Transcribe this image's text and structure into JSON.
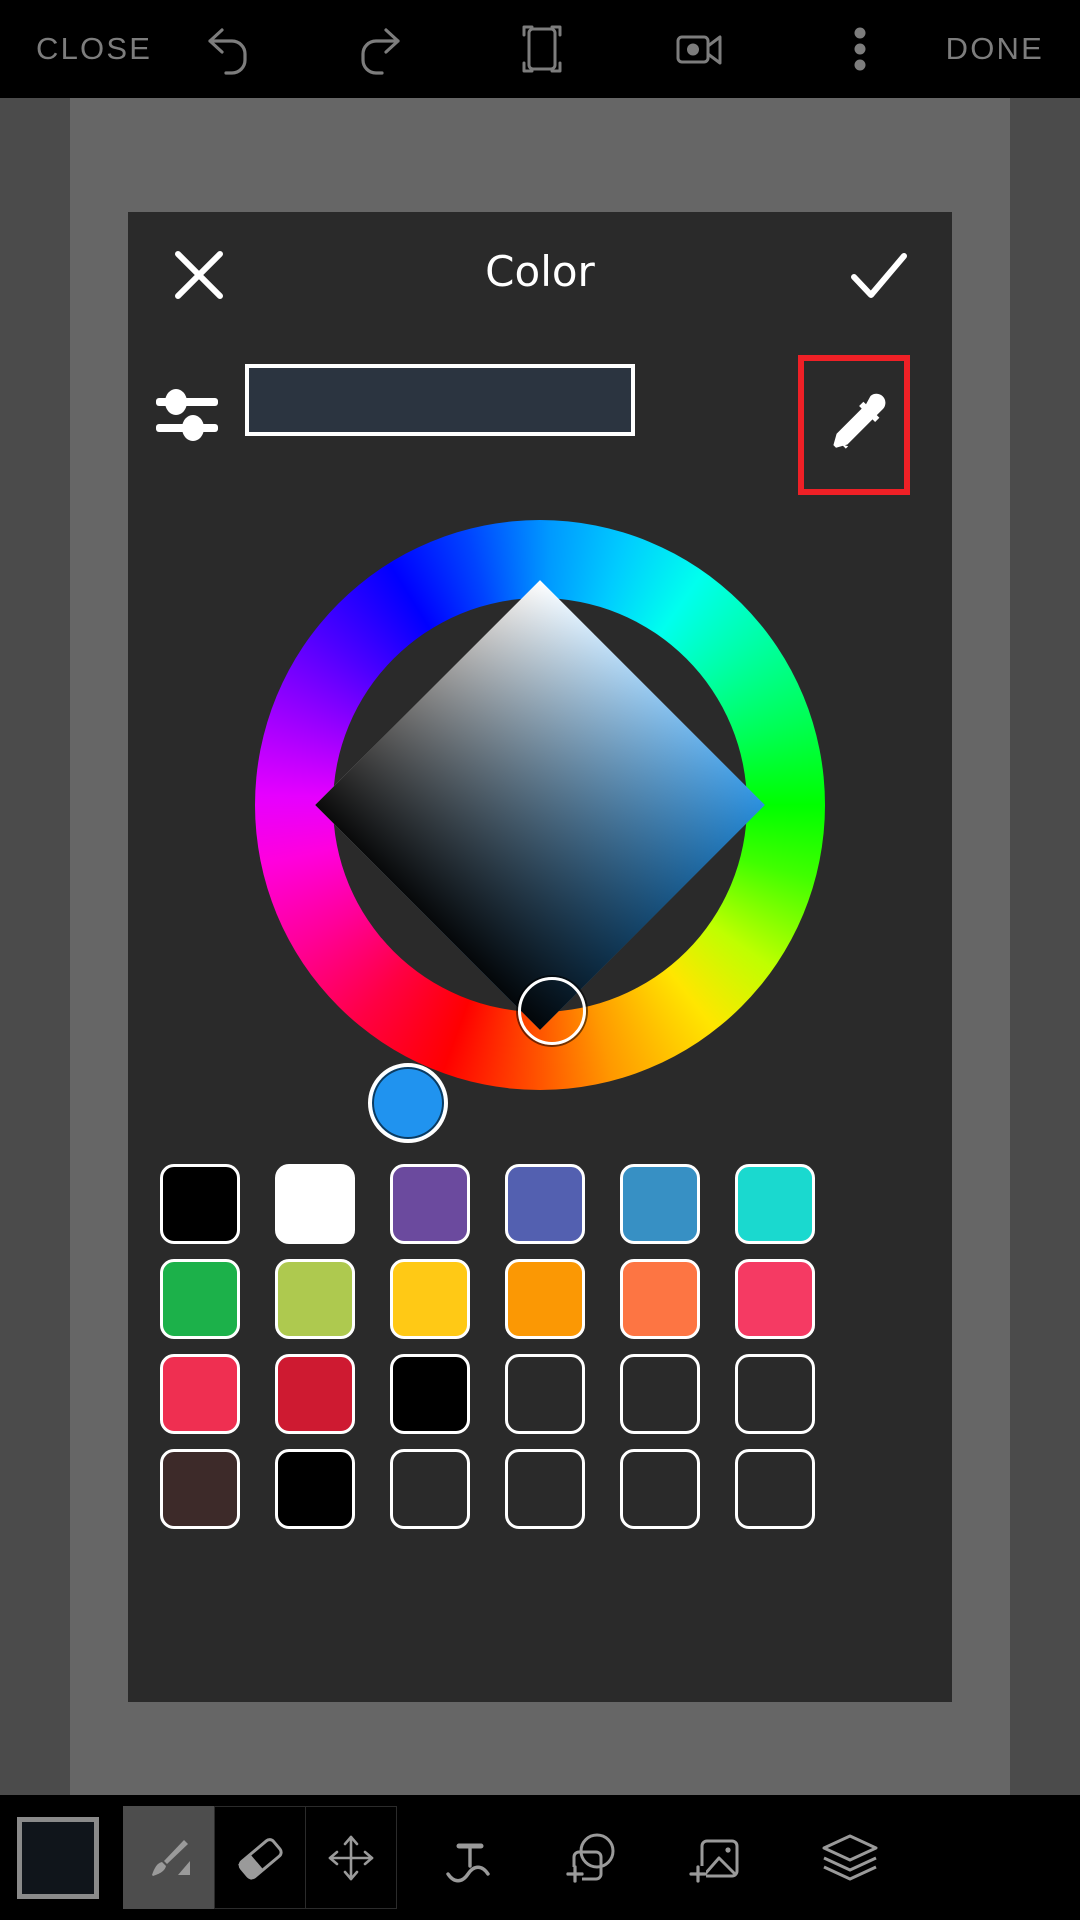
{
  "topbar": {
    "close_label": "CLOSE",
    "done_label": "DONE",
    "icons": [
      "undo-icon",
      "redo-icon",
      "crop-icon",
      "camera-icon",
      "overflow-menu-icon"
    ],
    "text_color": "#7d7d7d",
    "background": "#000000"
  },
  "canvas": {
    "backdrop_color": "#4b4b4b",
    "page_color": "#666666"
  },
  "dialog": {
    "title": "Color",
    "background": "#2a2a2a",
    "close_icon": "close-x-icon",
    "confirm_icon": "check-icon",
    "sliders_icon": "sliders-icon",
    "eyedropper_icon": "eyedropper-icon",
    "preview_color": "#2b3440",
    "highlight_color": "#ef2026",
    "highlight_target": "eyedropper-button"
  },
  "wheel": {
    "type": "hue-ring-with-sv-diamond",
    "selected_hue_color": "#2093ef",
    "sv_handle_color": "#1d232b",
    "diamond_tint": "#2a8fdd"
  },
  "swatches": [
    {
      "name": "black",
      "color": "#000000",
      "empty": false
    },
    {
      "name": "white",
      "color": "#ffffff",
      "empty": false
    },
    {
      "name": "purple",
      "color": "#6b4a9e",
      "empty": false
    },
    {
      "name": "indigo",
      "color": "#5360b0",
      "empty": false
    },
    {
      "name": "steel-blue",
      "color": "#3790c4",
      "empty": false
    },
    {
      "name": "turquoise",
      "color": "#1ad9cf",
      "empty": false
    },
    {
      "name": "green",
      "color": "#1cb14a",
      "empty": false
    },
    {
      "name": "yellow-green",
      "color": "#aec94f",
      "empty": false
    },
    {
      "name": "gold",
      "color": "#ffc915",
      "empty": false
    },
    {
      "name": "orange",
      "color": "#fb9804",
      "empty": false
    },
    {
      "name": "coral",
      "color": "#fd7543",
      "empty": false
    },
    {
      "name": "pink-red",
      "color": "#f53a63",
      "empty": false
    },
    {
      "name": "crimson",
      "color": "#ef2f51",
      "empty": false
    },
    {
      "name": "dark-red",
      "color": "#ce1a31",
      "empty": false
    },
    {
      "name": "black-2",
      "color": "#000000",
      "empty": false
    },
    {
      "name": "empty-1",
      "color": "transparent",
      "empty": true
    },
    {
      "name": "empty-2",
      "color": "transparent",
      "empty": true
    },
    {
      "name": "empty-3",
      "color": "transparent",
      "empty": true
    },
    {
      "name": "dark-brown",
      "color": "#3d2a29",
      "empty": false
    },
    {
      "name": "black-3",
      "color": "#000000",
      "empty": false
    },
    {
      "name": "empty-4",
      "color": "transparent",
      "empty": true
    },
    {
      "name": "empty-5",
      "color": "transparent",
      "empty": true
    },
    {
      "name": "empty-6",
      "color": "transparent",
      "empty": true
    },
    {
      "name": "empty-7",
      "color": "transparent",
      "empty": true
    }
  ],
  "bottombar": {
    "current_color": "#10151b",
    "tools": [
      {
        "name": "brush-tool",
        "icon": "brush-icon",
        "active": true
      },
      {
        "name": "eraser-tool",
        "icon": "eraser-icon",
        "active": false
      },
      {
        "name": "move-tool",
        "icon": "move-arrows-icon",
        "active": false
      }
    ],
    "actions": [
      {
        "name": "text-tool",
        "icon": "text-on-path-icon"
      },
      {
        "name": "add-shape",
        "icon": "add-shape-icon"
      },
      {
        "name": "add-image",
        "icon": "add-image-icon"
      },
      {
        "name": "layers",
        "icon": "layers-icon"
      }
    ],
    "background": "#000000"
  }
}
